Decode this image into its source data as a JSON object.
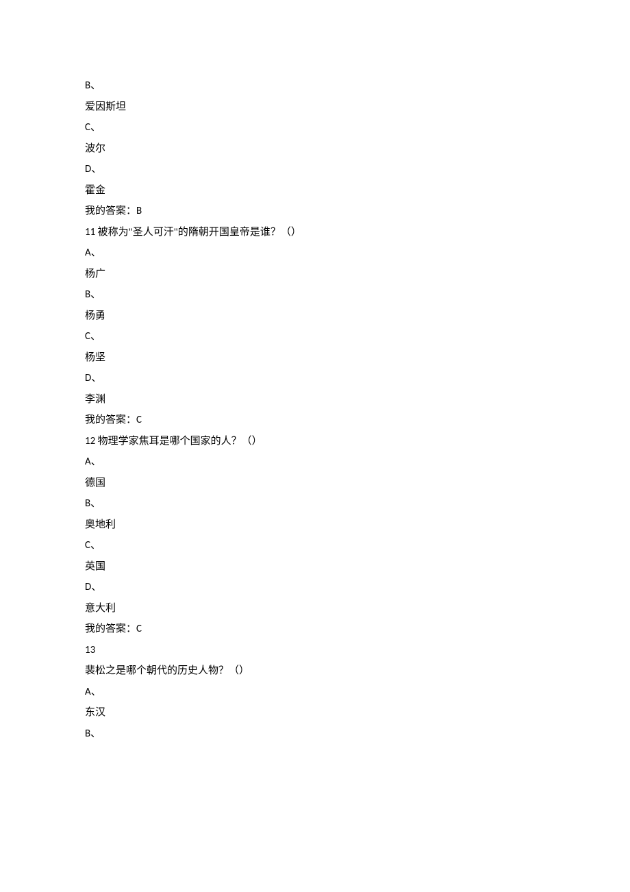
{
  "lines": [
    {
      "text": "B、",
      "type": "option-label"
    },
    {
      "text": "爱因斯坦",
      "type": "option-text"
    },
    {
      "text": "C、",
      "type": "option-label"
    },
    {
      "text": "波尔",
      "type": "option-text"
    },
    {
      "text": "D、",
      "type": "option-label"
    },
    {
      "text": "霍金",
      "type": "option-text"
    },
    {
      "prefix": "我的答案：",
      "answer": "B",
      "type": "answer"
    },
    {
      "num": "11 ",
      "text": "被称为\"圣人可汗\"的隋朝开国皇帝是谁？（）",
      "type": "question"
    },
    {
      "text": "A、",
      "type": "option-label"
    },
    {
      "text": "杨广",
      "type": "option-text"
    },
    {
      "text": "B、",
      "type": "option-label"
    },
    {
      "text": "杨勇",
      "type": "option-text"
    },
    {
      "text": "C、",
      "type": "option-label"
    },
    {
      "text": "杨坚",
      "type": "option-text"
    },
    {
      "text": "D、",
      "type": "option-label"
    },
    {
      "text": "李渊",
      "type": "option-text"
    },
    {
      "prefix": "我的答案：",
      "answer": "C",
      "type": "answer"
    },
    {
      "num": "12 ",
      "text": "物理学家焦耳是哪个国家的人？（）",
      "type": "question"
    },
    {
      "text": "A、",
      "type": "option-label"
    },
    {
      "text": "德国",
      "type": "option-text"
    },
    {
      "text": "B、",
      "type": "option-label"
    },
    {
      "text": "奥地利",
      "type": "option-text"
    },
    {
      "text": "C、",
      "type": "option-label"
    },
    {
      "text": "英国",
      "type": "option-text"
    },
    {
      "text": "D、",
      "type": "option-label"
    },
    {
      "text": "意大利",
      "type": "option-text"
    },
    {
      "prefix": "我的答案：",
      "answer": "C",
      "type": "answer"
    },
    {
      "text": "13",
      "type": "question-num-only"
    },
    {
      "text": "裴松之是哪个朝代的历史人物？（）",
      "type": "question-text"
    },
    {
      "text": "A、",
      "type": "option-label"
    },
    {
      "text": "东汉",
      "type": "option-text"
    },
    {
      "text": "B、",
      "type": "option-label"
    }
  ]
}
